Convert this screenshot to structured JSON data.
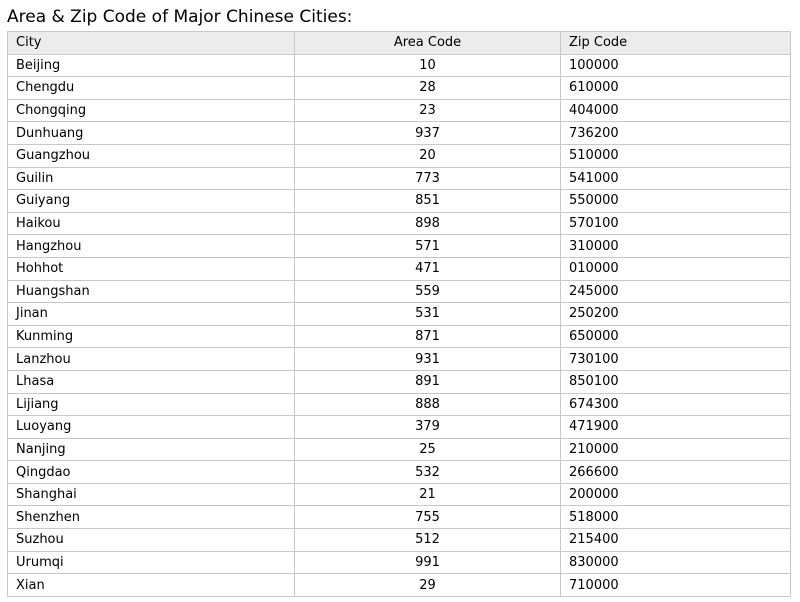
{
  "title": "Area & Zip Code of Major Chinese Cities:",
  "table": {
    "headers": [
      "City",
      "Area Code",
      "Zip Code"
    ],
    "rows": [
      [
        "Beijing",
        "10",
        "100000"
      ],
      [
        "Chengdu",
        "28",
        "610000"
      ],
      [
        "Chongqing",
        "23",
        "404000"
      ],
      [
        "Dunhuang",
        "937",
        "736200"
      ],
      [
        "Guangzhou",
        "20",
        "510000"
      ],
      [
        "Guilin",
        "773",
        "541000"
      ],
      [
        "Guiyang",
        "851",
        "550000"
      ],
      [
        "Haikou",
        "898",
        "570100"
      ],
      [
        "Hangzhou",
        "571",
        "310000"
      ],
      [
        "Hohhot",
        "471",
        "010000"
      ],
      [
        "Huangshan",
        "559",
        "245000"
      ],
      [
        "Jinan",
        "531",
        "250200"
      ],
      [
        "Kunming",
        "871",
        "650000"
      ],
      [
        "Lanzhou",
        "931",
        "730100"
      ],
      [
        "Lhasa",
        "891",
        "850100"
      ],
      [
        "Lijiang",
        "888",
        "674300"
      ],
      [
        "Luoyang",
        "379",
        "471900"
      ],
      [
        "Nanjing",
        "25",
        "210000"
      ],
      [
        "Qingdao",
        "532",
        "266600"
      ],
      [
        "Shanghai",
        "21",
        "200000"
      ],
      [
        "Shenzhen",
        "755",
        "518000"
      ],
      [
        "Suzhou",
        "512",
        "215400"
      ],
      [
        "Urumqi",
        "991",
        "830000"
      ],
      [
        "Xian",
        "29",
        "710000"
      ]
    ]
  }
}
